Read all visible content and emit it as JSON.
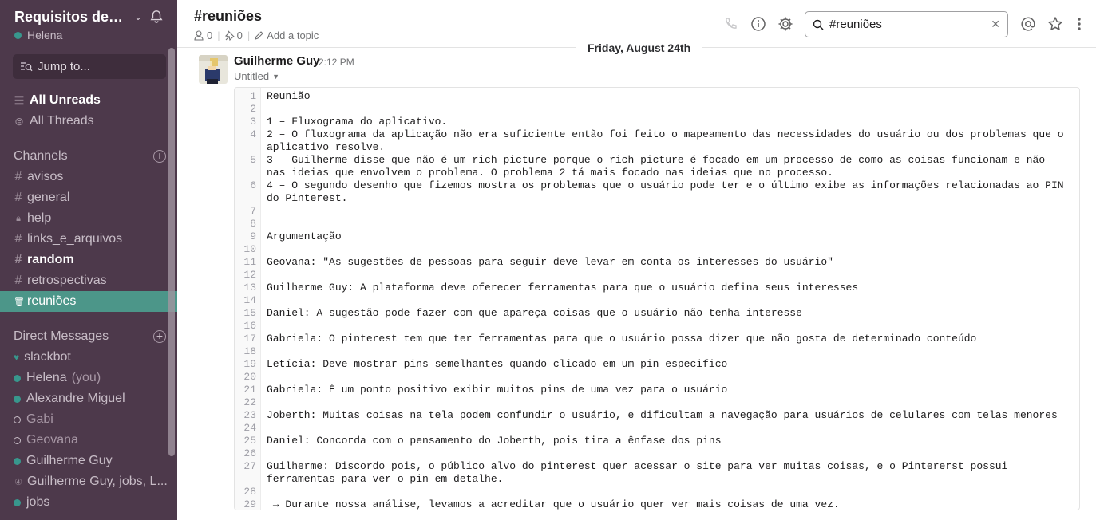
{
  "workspace": {
    "name": "Requisitos de Software",
    "user": "Helena"
  },
  "sidebar": {
    "jump_label": "Jump to...",
    "all_unreads": "All Unreads",
    "all_threads": "All Threads",
    "channels_title": "Channels",
    "channels": [
      {
        "name": "avisos",
        "icon": "hash"
      },
      {
        "name": "general",
        "icon": "hash"
      },
      {
        "name": "help",
        "icon": "lock"
      },
      {
        "name": "links_e_arquivos",
        "icon": "hash"
      },
      {
        "name": "random",
        "icon": "hash",
        "bold": true
      },
      {
        "name": "retrospectivas",
        "icon": "hash"
      },
      {
        "name": "reuniões",
        "icon": "trash",
        "active": true
      }
    ],
    "dm_title": "Direct Messages",
    "dms": [
      {
        "name": "slackbot",
        "status": "heart"
      },
      {
        "name": "Helena",
        "suffix": "(you)",
        "status": "online"
      },
      {
        "name": "Alexandre Miguel",
        "status": "online"
      },
      {
        "name": "Gabi",
        "status": "away"
      },
      {
        "name": "Geovana",
        "status": "away"
      },
      {
        "name": "Guilherme Guy",
        "status": "online"
      },
      {
        "name": "Guilherme Guy, jobs, L...",
        "status": "group"
      },
      {
        "name": "jobs",
        "status": "online"
      }
    ]
  },
  "header": {
    "channel": "#reuniões",
    "members": "0",
    "pins": "0",
    "add_topic": "Add a topic",
    "search_value": "#reuniões",
    "icons": [
      "phone-icon",
      "info-icon",
      "gear-icon",
      "at-icon",
      "star-icon",
      "more-icon"
    ]
  },
  "message": {
    "date": "Friday, August 24th",
    "author": "Guilherme Guy",
    "time": "2:12 PM",
    "file_title": "Untitled",
    "lines": [
      {
        "n": "1",
        "text": "Reunião"
      },
      {
        "n": "2",
        "text": ""
      },
      {
        "n": "3",
        "text": "1 – Fluxograma do aplicativo."
      },
      {
        "n": "4",
        "text": "2 – O fluxograma da aplicação não era suficiente então foi feito o mapeamento das necessidades do usuário ou dos problemas que o aplicativo resolve."
      },
      {
        "n": "5",
        "text": "3 – Guilherme disse que não é um rich picture porque o rich picture é focado em um processo de como as coisas funcionam e não nas ideias que envolvem o problema. O problema 2 tá mais focado nas ideias que no processo."
      },
      {
        "n": "6",
        "text": "4 – O segundo desenho que fizemos mostra os problemas que o usuário pode ter e o último exibe as informações relacionadas ao PIN do Pinterest."
      },
      {
        "n": "7",
        "text": ""
      },
      {
        "n": "8",
        "text": ""
      },
      {
        "n": "9",
        "text": "Argumentação"
      },
      {
        "n": "10",
        "text": ""
      },
      {
        "n": "11",
        "text": "Geovana: \"As sugestões de pessoas para seguir deve levar em conta os interesses do usuário\""
      },
      {
        "n": "12",
        "text": ""
      },
      {
        "n": "13",
        "text": "Guilherme Guy: A plataforma deve oferecer ferramentas para que o usuário defina seus interesses"
      },
      {
        "n": "14",
        "text": ""
      },
      {
        "n": "15",
        "text": "Daniel: A sugestão pode fazer com que apareça coisas que o usuário não tenha interesse"
      },
      {
        "n": "16",
        "text": ""
      },
      {
        "n": "17",
        "text": "Gabriela: O pinterest tem que ter ferramentas para que o usuário possa dizer que não gosta de determinado conteúdo"
      },
      {
        "n": "18",
        "text": ""
      },
      {
        "n": "19",
        "text": "Letícia: Deve mostrar pins semelhantes quando clicado em um pin especifico"
      },
      {
        "n": "20",
        "text": ""
      },
      {
        "n": "21",
        "text": "Gabriela: É um ponto positivo exibir muitos pins de uma vez para o usuário"
      },
      {
        "n": "22",
        "text": ""
      },
      {
        "n": "23",
        "text": "Joberth: Muitas coisas na tela podem confundir o usuário, e dificultam a navegação para usuários de celulares com telas menores"
      },
      {
        "n": "24",
        "text": ""
      },
      {
        "n": "25",
        "text": "Daniel: Concorda com o pensamento do Joberth, pois tira a ênfase dos pins"
      },
      {
        "n": "26",
        "text": ""
      },
      {
        "n": "27",
        "text": "Guilherme: Discordo pois, o público alvo do pinterest quer acessar o site para ver muitas coisas, e o Pintererst possui ferramentas para ver o pin em detalhe."
      },
      {
        "n": "28",
        "text": ""
      },
      {
        "n": "29",
        "text": " → Durante nossa análise, levamos a acreditar que o usuário quer ver mais coisas de uma vez."
      }
    ]
  }
}
